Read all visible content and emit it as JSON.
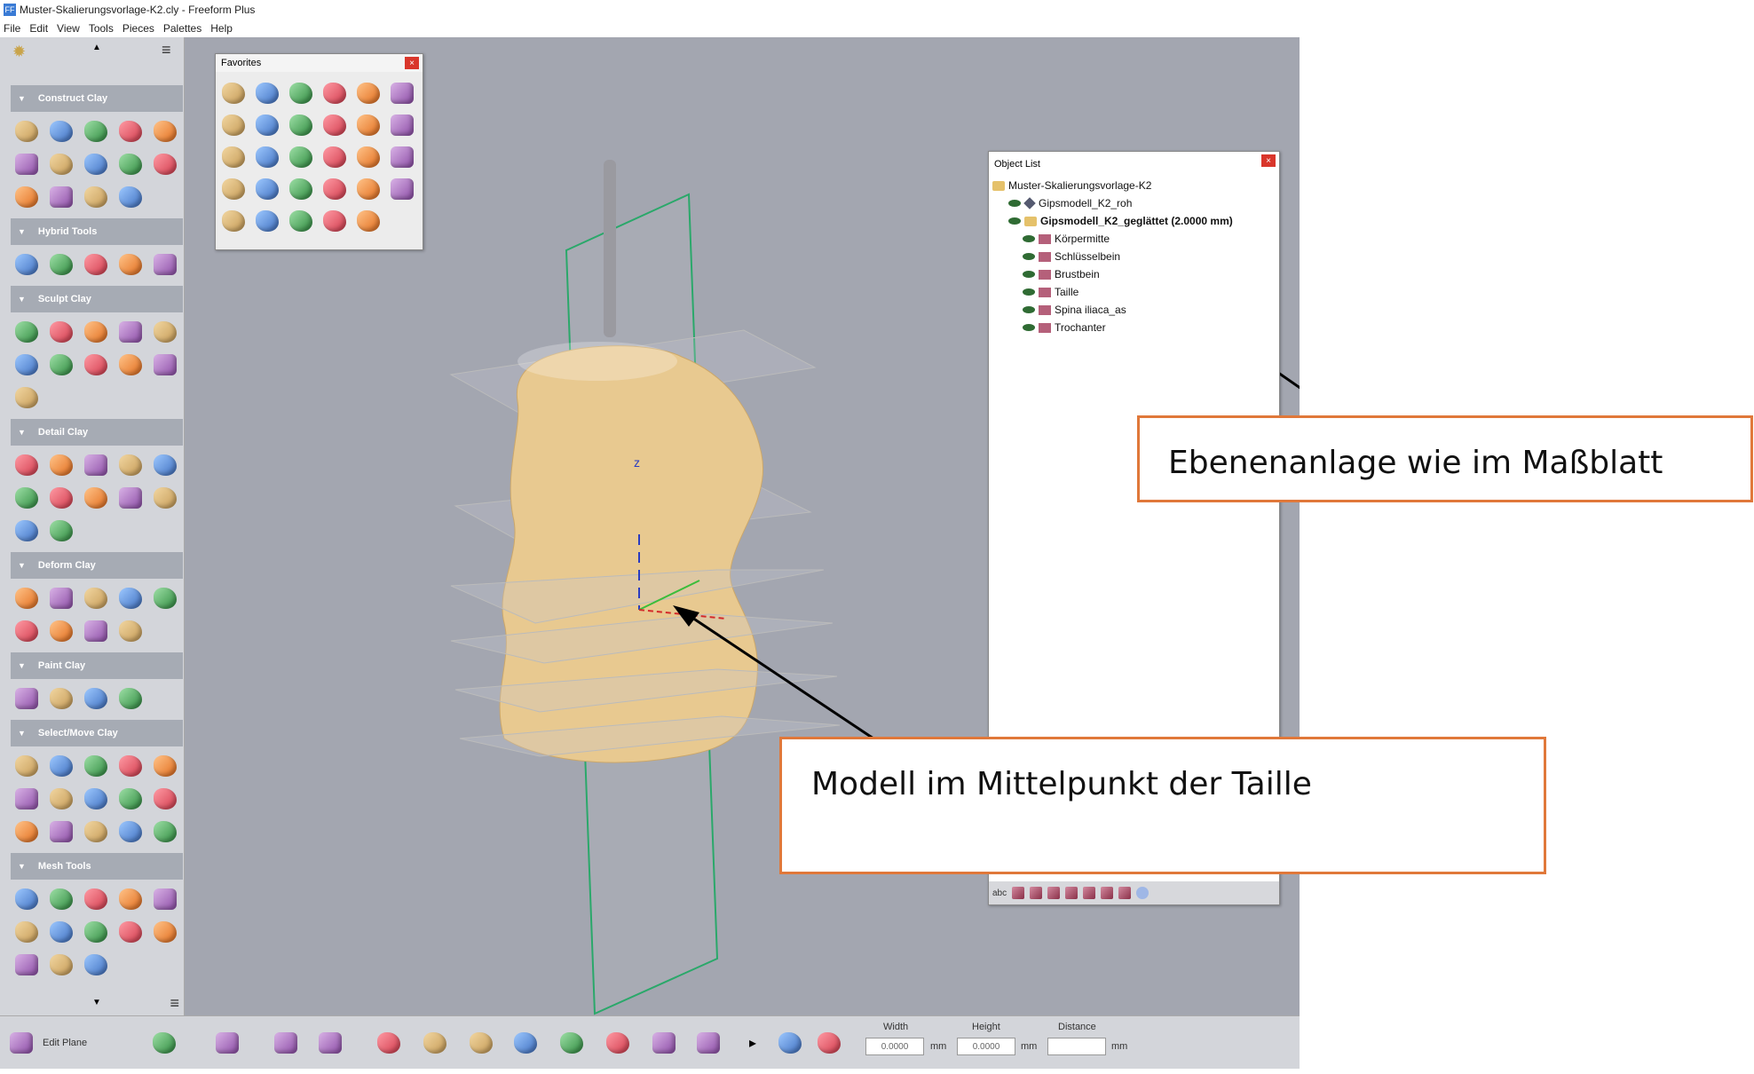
{
  "window": {
    "title": "Muster-Skalierungsvorlage-K2.cly - Freeform Plus",
    "app_icon": "FF"
  },
  "menu": [
    "File",
    "Edit",
    "View",
    "Tools",
    "Pieces",
    "Palettes",
    "Help"
  ],
  "left_panel": {
    "sections": [
      {
        "label": "Construct Clay",
        "tool_count": 14
      },
      {
        "label": "Hybrid Tools",
        "tool_count": 5
      },
      {
        "label": "Sculpt Clay",
        "tool_count": 11
      },
      {
        "label": "Detail Clay",
        "tool_count": 12
      },
      {
        "label": "Deform Clay",
        "tool_count": 9
      },
      {
        "label": "Paint Clay",
        "tool_count": 4
      },
      {
        "label": "Select/Move Clay",
        "tool_count": 15
      },
      {
        "label": "Mesh Tools",
        "tool_count": 13
      }
    ]
  },
  "favorites": {
    "title": "Favorites",
    "close": "×",
    "tool_count": 29
  },
  "object_list": {
    "title": "Object List",
    "close": "×",
    "root": "Muster-Skalierungsvorlage-K2",
    "items": [
      {
        "label": "Gipsmodell_K2_roh",
        "level": 1,
        "bold": false
      },
      {
        "label": "Gipsmodell_K2_geglättet (2.0000 mm)",
        "level": 1,
        "bold": true
      },
      {
        "label": "Körpermitte",
        "level": 2,
        "bold": false
      },
      {
        "label": "Schlüsselbein",
        "level": 2,
        "bold": false
      },
      {
        "label": "Brustbein",
        "level": 2,
        "bold": false
      },
      {
        "label": "Taille",
        "level": 2,
        "bold": false
      },
      {
        "label": "Spina iliaca_as",
        "level": 2,
        "bold": false
      },
      {
        "label": "Trochanter",
        "level": 2,
        "bold": false
      }
    ],
    "bottom_label": "abc"
  },
  "viewport": {
    "axis_z": "z"
  },
  "annotations": {
    "callout1": "Ebenenanlage wie im Maßblatt",
    "callout2": "Modell  im Mittelpunkt der Taille"
  },
  "bottom_bar": {
    "edit_plane": "Edit Plane",
    "width_label": "Width",
    "width_value": "0.0000",
    "width_unit": "mm",
    "height_label": "Height",
    "height_value": "0.0000",
    "height_unit": "mm",
    "distance_label": "Distance",
    "distance_value": "",
    "distance_unit": "mm"
  },
  "colors": {
    "accent_callout": "#e0783a",
    "viewport_bg": "#a3a6b0",
    "clay": "#e8c990",
    "plane_green": "#2aa86a"
  }
}
